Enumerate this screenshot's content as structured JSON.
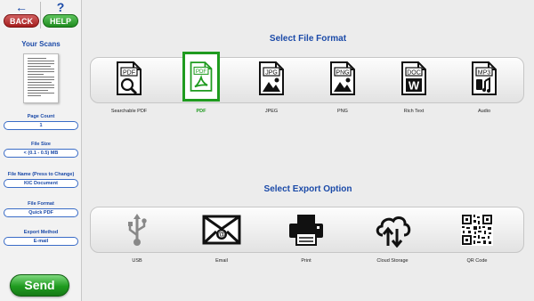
{
  "nav": {
    "back_label": "BACK",
    "back_glyph": "←",
    "help_label": "HELP",
    "help_glyph": "?"
  },
  "sidebar": {
    "your_scans": "Your Scans",
    "fields": [
      {
        "label": "Page Count",
        "value": "1"
      },
      {
        "label": "File Size",
        "value": "< (0.1 - 0.5) MB"
      },
      {
        "label": "File Name (Press to Change)",
        "value": "KIC Document"
      },
      {
        "label": "File Format",
        "value": "Quick PDF"
      },
      {
        "label": "Export Method",
        "value": "E-mail"
      }
    ],
    "send_label": "Send"
  },
  "file_format": {
    "title": "Select File Format",
    "options": [
      {
        "label": "Searchable PDF",
        "icon": "searchable-pdf-icon",
        "tag": "PDF"
      },
      {
        "label": "PDF",
        "icon": "pdf-icon",
        "tag": "PDF",
        "selected": true
      },
      {
        "label": "JPEG",
        "icon": "jpeg-icon",
        "tag": "JPG"
      },
      {
        "label": "PNG",
        "icon": "png-icon",
        "tag": "PNG"
      },
      {
        "label": "Rich Text",
        "icon": "rich-text-icon",
        "tag": "DOC"
      },
      {
        "label": "Audio",
        "icon": "audio-icon",
        "tag": "MP3"
      }
    ]
  },
  "export_option": {
    "title": "Select Export Option",
    "options": [
      {
        "label": "USB",
        "icon": "usb-icon"
      },
      {
        "label": "Email",
        "icon": "email-icon"
      },
      {
        "label": "Print",
        "icon": "printer-icon"
      },
      {
        "label": "Cloud Storage",
        "icon": "cloud-icon"
      },
      {
        "label": "QR Code",
        "icon": "qr-code-icon"
      }
    ]
  },
  "colors": {
    "accent_blue": "#1b4aa8",
    "selected_green": "#1f9b1f",
    "back_red": "#a51e1e"
  }
}
